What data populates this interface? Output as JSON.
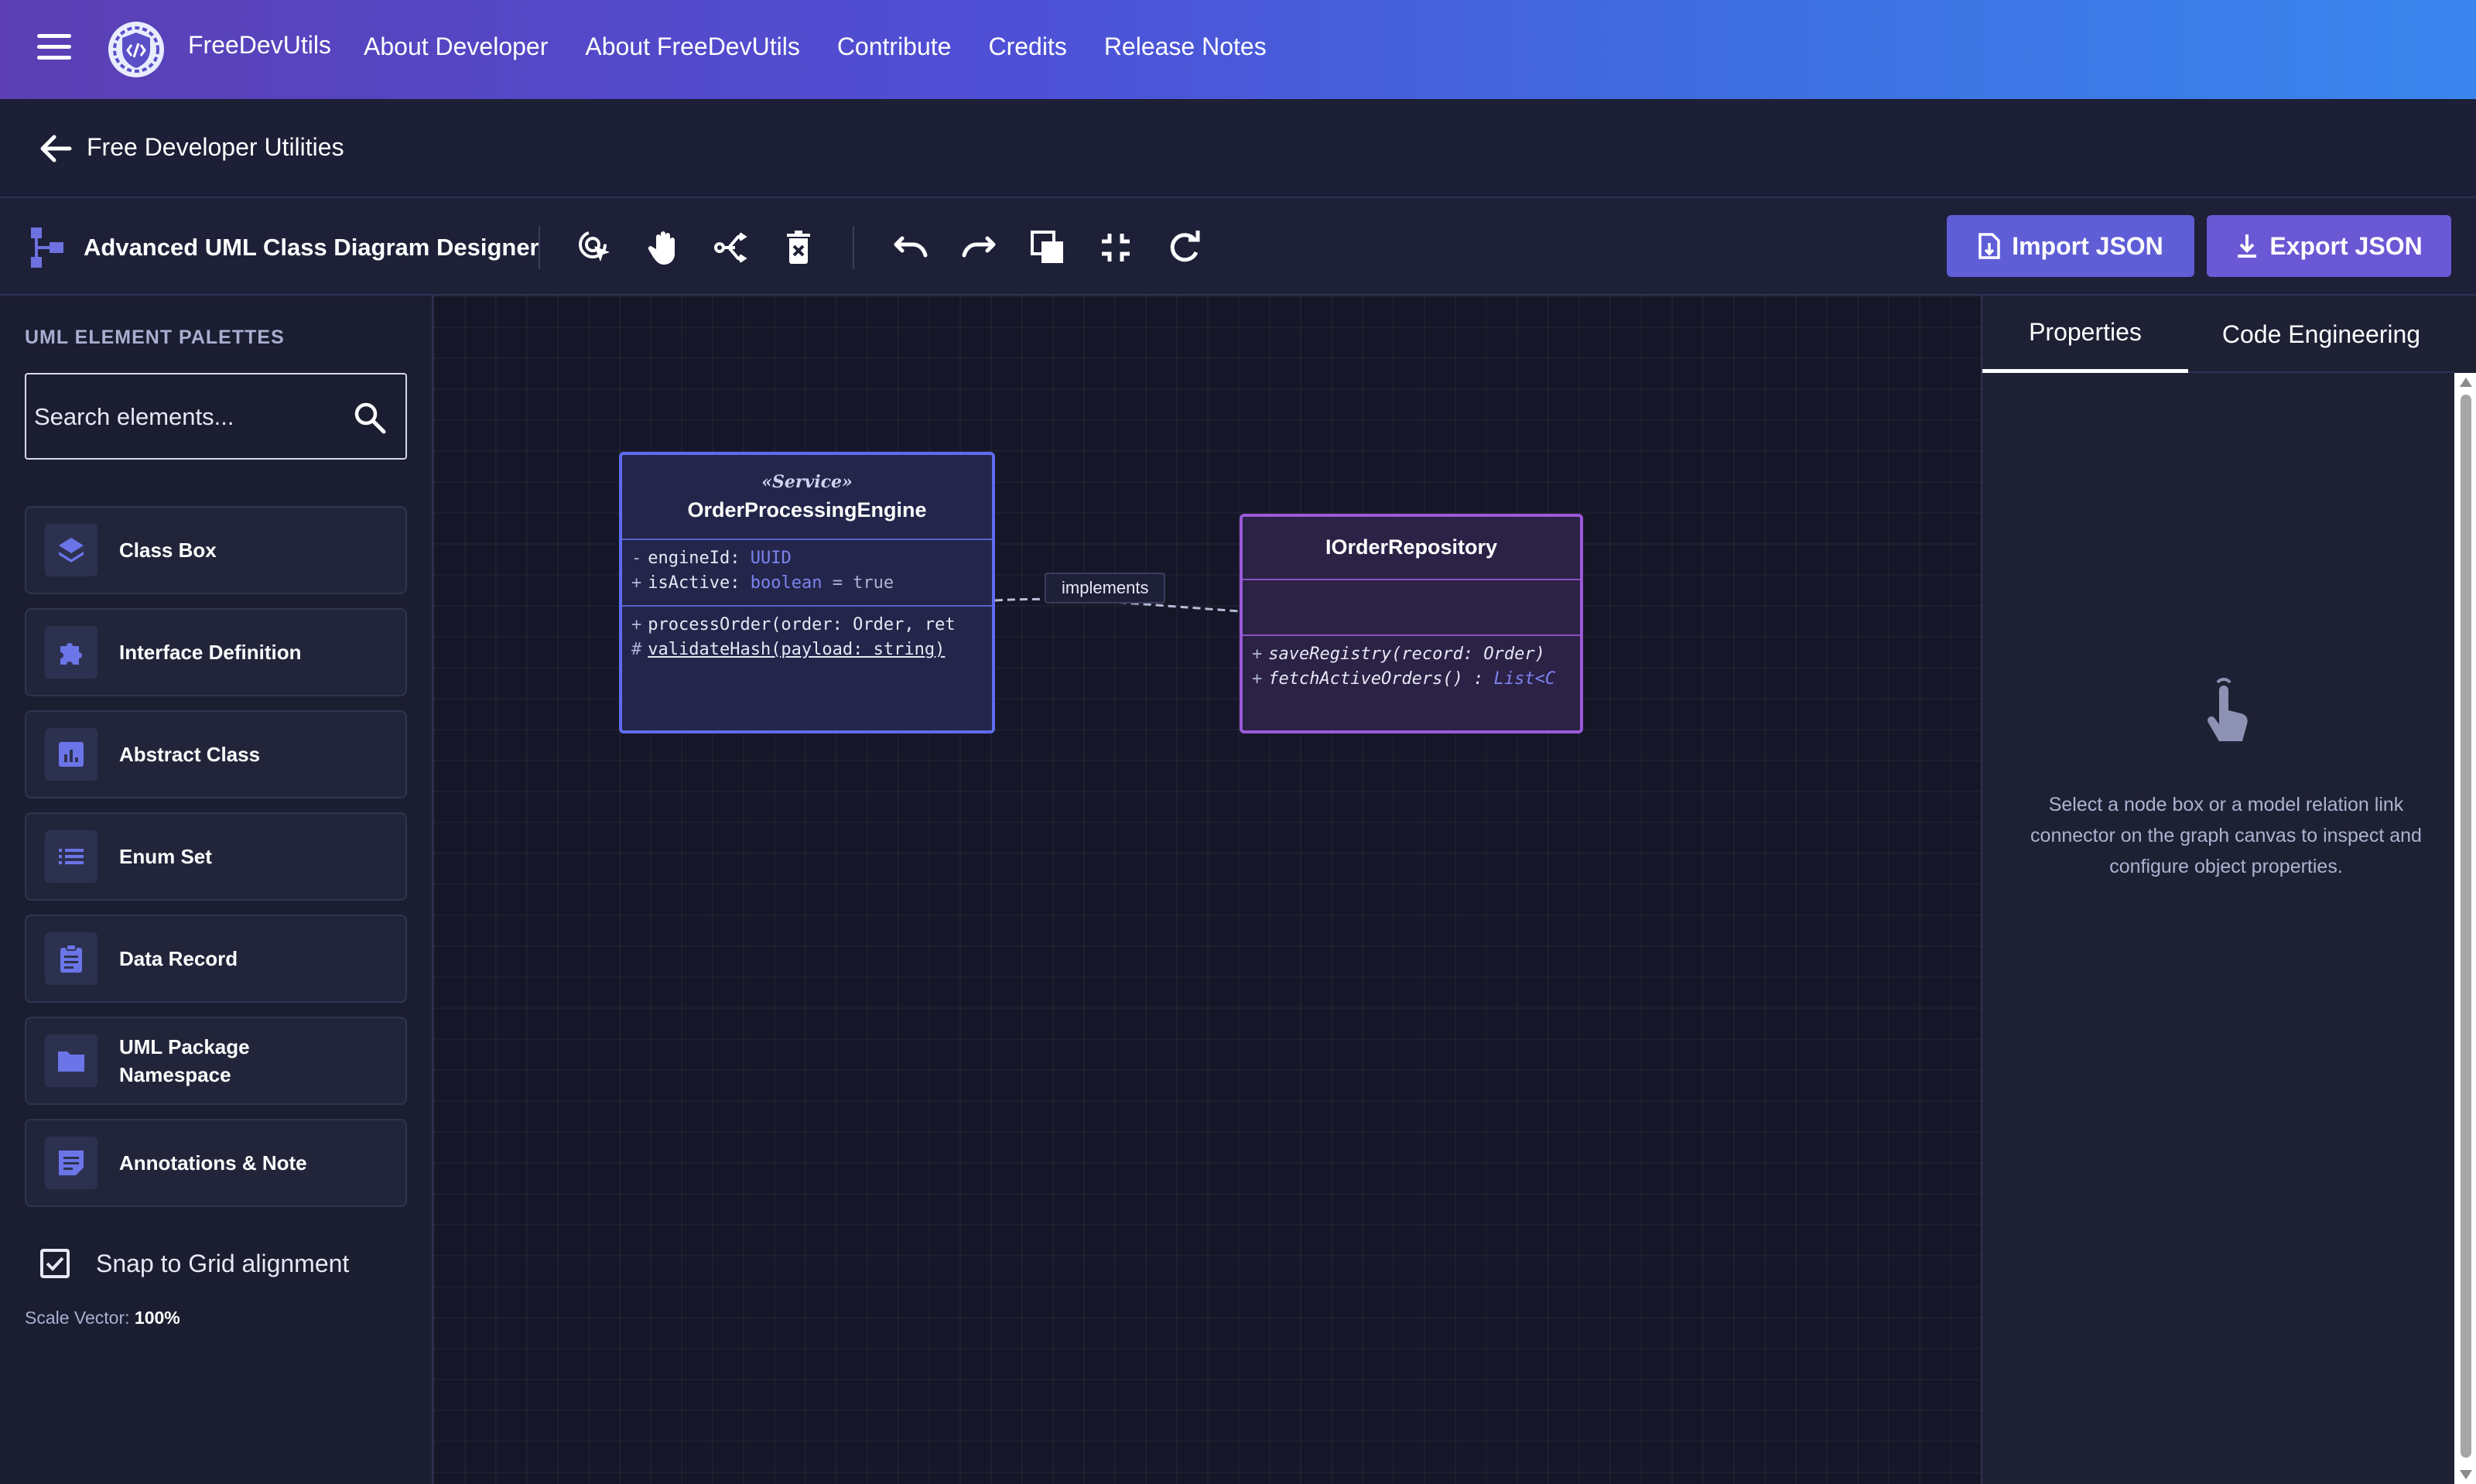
{
  "nav": {
    "brand": "FreeDevUtils",
    "links": [
      "About Developer",
      "About FreeDevUtils",
      "Contribute",
      "Credits",
      "Release Notes"
    ]
  },
  "breadcrumb": {
    "title": "Free Developer Utilities"
  },
  "toolbar": {
    "title": "Advanced UML Class Diagram Designer",
    "tools": [
      "select-tool-icon",
      "pan-hand-icon",
      "connector-icon",
      "delete-icon",
      "undo-icon",
      "redo-icon",
      "duplicate-icon",
      "fit-view-icon",
      "reset-icon"
    ],
    "import_label": "Import JSON",
    "export_label": "Export JSON"
  },
  "sidebar": {
    "heading": "UML ELEMENT PALETTES",
    "search_placeholder": "Search elements...",
    "items": [
      {
        "label": "Class Box",
        "icon": "layers-icon"
      },
      {
        "label": "Interface Definition",
        "icon": "puzzle-icon"
      },
      {
        "label": "Abstract Class",
        "icon": "chart-box-icon"
      },
      {
        "label": "Enum Set",
        "icon": "list-icon"
      },
      {
        "label": "Data Record",
        "icon": "clipboard-icon"
      },
      {
        "label": "UML Package Namespace",
        "icon": "folder-icon"
      },
      {
        "label": "Annotations & Note",
        "icon": "note-icon"
      }
    ],
    "snap_label": "Snap to Grid alignment",
    "snap_checked": true,
    "scale_label": "Scale Vector:",
    "scale_value": "100%"
  },
  "diagram": {
    "service": {
      "stereotype": "«Service»",
      "name": "OrderProcessingEngine",
      "attributes": [
        {
          "vis": "-",
          "name": "engineId:",
          "type": "UUID",
          "extra": ""
        },
        {
          "vis": "+",
          "name": "isActive:",
          "type": "boolean",
          "extra": "= true"
        }
      ],
      "operations": [
        {
          "vis": "+",
          "text": "processOrder(order: Order, ret"
        },
        {
          "vis": "#",
          "text": "validateHash(payload: string)"
        }
      ]
    },
    "repository": {
      "name": "IOrderRepository",
      "operations": [
        {
          "vis": "+",
          "text": "saveRegistry(record: Order)",
          "type": ""
        },
        {
          "vis": "+",
          "text": "fetchActiveOrders() :",
          "type": "List<C"
        }
      ]
    },
    "connector_label": "implements"
  },
  "properties_panel": {
    "tabs": [
      "Properties",
      "Code Engineering"
    ],
    "empty_message": "Select a node box or a model relation link connector on the graph canvas to inspect and configure object properties."
  },
  "colors": {
    "accent": "#5e6cf0",
    "interface_border": "#9b59d9",
    "canvas_bg": "#151627"
  }
}
